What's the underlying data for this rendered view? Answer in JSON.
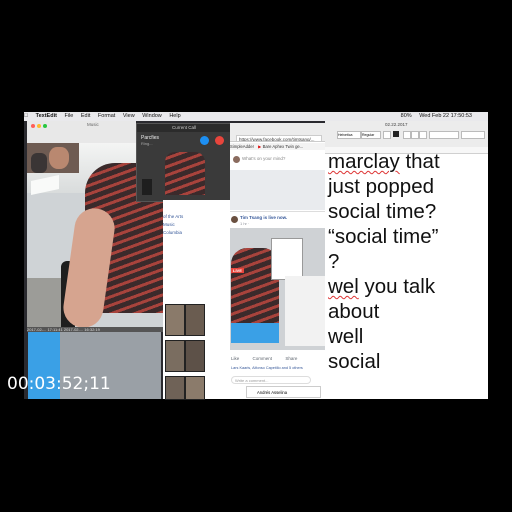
{
  "menubar": {
    "apple": "",
    "app": "TextEdit",
    "items": [
      "File",
      "Edit",
      "Format",
      "View",
      "Window",
      "Help"
    ],
    "clock": "Wed Feb 22  17:50:53",
    "battery": "80%"
  },
  "video": {
    "timestamps": "2017-02-... 17:11:41   2017-02-... 16:32:19"
  },
  "call": {
    "title": "Current Call",
    "caller": "Parcfies",
    "status": "Ring..."
  },
  "music_label": "Music",
  "browser": {
    "url": "https://www.facebook.com/timtsang/...",
    "bookmarks": [
      "SimpleAdder",
      "Bare Aphex Twin ge..."
    ],
    "status_prompt": "What's on your mind?",
    "sidebar_links": [
      "of the Arts",
      "Music",
      "Columbia"
    ],
    "post_author": "Tim Tsang is live now.",
    "post_meta": "1 hr ·",
    "live_badge": "LIVE",
    "actions": [
      "Like",
      "Comment",
      "Share"
    ],
    "reactions": "Lars Kaaris, Alfonso Capetillo and 5 others",
    "comment_placeholder": "Write a comment...",
    "commenter": "Andrés Asselina",
    "commenter2": "Tim Tsang"
  },
  "textedit": {
    "title": "02.22.2017",
    "font": "Helvetica",
    "style": "Regular",
    "lines": [
      "marclay that",
      "just popped",
      "social time?",
      "“social time”",
      "?",
      "wel you talk",
      "about",
      "well",
      "social"
    ]
  },
  "timecode": "00:03:52;11"
}
